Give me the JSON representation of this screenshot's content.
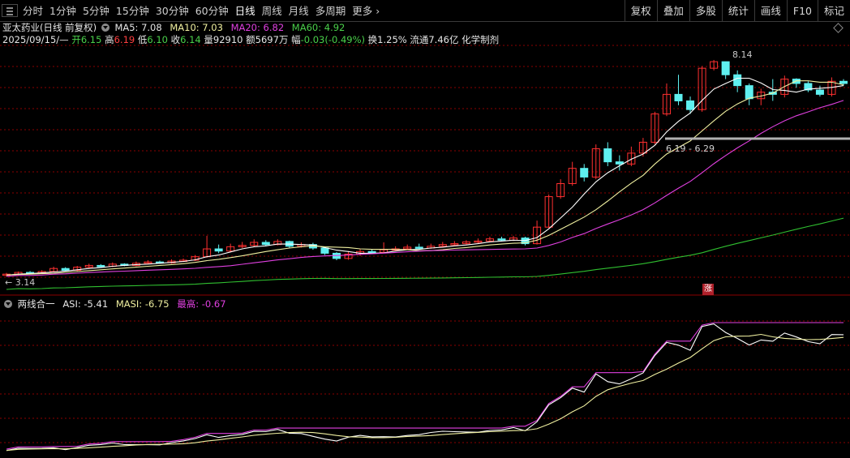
{
  "toolbar": {
    "period_tabs": [
      "分时",
      "1分钟",
      "5分钟",
      "15分钟",
      "30分钟",
      "60分钟",
      "日线",
      "周线",
      "月线",
      "多周期",
      "更多"
    ],
    "active_tab": "日线",
    "right_tools": [
      "复权",
      "叠加",
      "多股",
      "统计",
      "画线",
      "F10",
      "标记"
    ]
  },
  "info": {
    "stock": "亚太药业(日线 前复权)",
    "ma5": "MA5: 7.08",
    "ma10": "MA10: 7.03",
    "ma20": "MA20: 6.82",
    "ma60": "MA60: 4.92",
    "date": "2025/09/15/—",
    "open_label": "开",
    "open": "6.15",
    "high_label": "高",
    "high": "6.19",
    "low_label": "低",
    "low": "6.10",
    "close_label": "收",
    "close": "6.14",
    "vol_label": "量",
    "vol": "92910",
    "amt_label": "额",
    "amt": "5697万",
    "chg_label": "幅",
    "chg": "-0.03(-0.49%)",
    "turnover": "换1.25%",
    "float_cap": "流通7.46亿",
    "sector": "化学制剂"
  },
  "annotations": {
    "low_price": "← 3.14",
    "high_price": "8.14",
    "range": "6.19 - 6.29",
    "badge": "涨"
  },
  "indicator": {
    "name": "两线合一",
    "asi": "ASI: -5.41",
    "masi": "MASI: -6.75",
    "highest": "最高: -0.67"
  },
  "colors": {
    "up": "#ff3030",
    "down": "#5ff0f0",
    "ma5": "#ffffff",
    "ma10": "#f0f0a0",
    "ma20": "#e040e0",
    "ma60": "#30c030",
    "grid": "#8b0000"
  },
  "price_series": {
    "candles": [
      [
        3.2,
        3.22,
        3.16,
        3.25
      ],
      [
        3.22,
        3.26,
        3.19,
        3.28
      ],
      [
        3.26,
        3.24,
        3.22,
        3.29
      ],
      [
        3.24,
        3.28,
        3.22,
        3.31
      ],
      [
        3.28,
        3.35,
        3.26,
        3.39
      ],
      [
        3.35,
        3.31,
        3.29,
        3.38
      ],
      [
        3.31,
        3.38,
        3.29,
        3.41
      ],
      [
        3.38,
        3.42,
        3.36,
        3.46
      ],
      [
        3.42,
        3.4,
        3.37,
        3.45
      ],
      [
        3.4,
        3.45,
        3.38,
        3.49
      ],
      [
        3.45,
        3.42,
        3.4,
        3.47
      ],
      [
        3.42,
        3.47,
        3.4,
        3.51
      ],
      [
        3.47,
        3.5,
        3.45,
        3.54
      ],
      [
        3.5,
        3.48,
        3.46,
        3.53
      ],
      [
        3.48,
        3.52,
        3.46,
        3.56
      ],
      [
        3.52,
        3.54,
        3.5,
        3.58
      ],
      [
        3.54,
        3.62,
        3.52,
        3.66
      ],
      [
        3.62,
        3.8,
        3.6,
        4.1
      ],
      [
        3.8,
        3.75,
        3.7,
        3.9
      ],
      [
        3.75,
        3.85,
        3.72,
        3.92
      ],
      [
        3.85,
        3.88,
        3.82,
        3.96
      ],
      [
        3.88,
        3.95,
        3.85,
        4.02
      ],
      [
        3.95,
        3.9,
        3.86,
        4.0
      ],
      [
        3.9,
        3.97,
        3.88,
        4.02
      ],
      [
        3.97,
        3.86,
        3.82,
        3.99
      ],
      [
        3.86,
        3.9,
        3.83,
        3.95
      ],
      [
        3.9,
        3.82,
        3.78,
        3.94
      ],
      [
        3.82,
        3.7,
        3.66,
        3.85
      ],
      [
        3.7,
        3.58,
        3.54,
        3.73
      ],
      [
        3.58,
        3.68,
        3.55,
        3.75
      ],
      [
        3.68,
        3.74,
        3.64,
        3.8
      ],
      [
        3.74,
        3.72,
        3.68,
        3.8
      ],
      [
        3.72,
        3.78,
        3.7,
        3.95
      ],
      [
        3.78,
        3.8,
        3.75,
        3.86
      ],
      [
        3.8,
        3.84,
        3.78,
        3.9
      ],
      [
        3.84,
        3.82,
        3.78,
        3.92
      ],
      [
        3.82,
        3.86,
        3.8,
        3.92
      ],
      [
        3.86,
        3.9,
        3.84,
        3.96
      ],
      [
        3.9,
        3.92,
        3.88,
        3.98
      ],
      [
        3.92,
        3.96,
        3.9,
        4.0
      ],
      [
        3.96,
        3.98,
        3.93,
        4.04
      ],
      [
        3.98,
        4.03,
        3.96,
        4.08
      ],
      [
        4.03,
        4.0,
        3.98,
        4.08
      ],
      [
        4.0,
        4.05,
        3.98,
        4.1
      ],
      [
        4.05,
        3.92,
        3.88,
        4.08
      ],
      [
        3.92,
        4.3,
        3.9,
        4.45
      ],
      [
        4.3,
        5.0,
        4.28,
        5.05
      ],
      [
        5.0,
        5.3,
        4.95,
        5.4
      ],
      [
        5.3,
        5.65,
        5.25,
        5.8
      ],
      [
        5.65,
        5.45,
        5.35,
        5.75
      ],
      [
        5.45,
        6.1,
        5.4,
        6.2
      ],
      [
        6.1,
        5.8,
        5.7,
        6.25
      ],
      [
        5.8,
        5.75,
        5.6,
        5.95
      ],
      [
        5.75,
        6.0,
        5.7,
        6.15
      ],
      [
        6.0,
        6.25,
        5.92,
        6.35
      ],
      [
        6.25,
        6.9,
        6.2,
        6.95
      ],
      [
        6.9,
        7.35,
        6.85,
        7.6
      ],
      [
        7.35,
        7.2,
        7.1,
        7.8
      ],
      [
        7.2,
        7.0,
        6.9,
        7.3
      ],
      [
        7.0,
        7.95,
        6.95,
        8.0
      ],
      [
        7.95,
        8.1,
        7.9,
        8.14
      ],
      [
        8.1,
        7.8,
        7.7,
        8.05
      ],
      [
        7.8,
        7.55,
        7.4,
        7.9
      ],
      [
        7.55,
        7.25,
        7.1,
        7.6
      ],
      [
        7.25,
        7.4,
        7.1,
        7.48
      ],
      [
        7.4,
        7.35,
        7.2,
        7.7
      ],
      [
        7.35,
        7.7,
        7.28,
        7.78
      ],
      [
        7.7,
        7.6,
        7.5,
        7.72
      ],
      [
        7.6,
        7.45,
        7.4,
        7.65
      ],
      [
        7.45,
        7.35,
        7.3,
        7.55
      ],
      [
        7.35,
        7.65,
        7.3,
        7.74
      ],
      [
        7.65,
        7.6,
        7.55,
        7.7
      ]
    ],
    "ma5": [
      3.2,
      3.22,
      3.23,
      3.25,
      3.27,
      3.29,
      3.32,
      3.35,
      3.37,
      3.4,
      3.42,
      3.44,
      3.45,
      3.47,
      3.49,
      3.51,
      3.55,
      3.62,
      3.66,
      3.73,
      3.8,
      3.85,
      3.87,
      3.91,
      3.91,
      3.9,
      3.89,
      3.83,
      3.77,
      3.74,
      3.7,
      3.7,
      3.71,
      3.75,
      3.78,
      3.79,
      3.82,
      3.84,
      3.87,
      3.89,
      3.92,
      3.96,
      3.98,
      4.0,
      3.99,
      4.06,
      4.26,
      4.51,
      4.76,
      5.06,
      5.34,
      5.55,
      5.71,
      5.86,
      5.98,
      6.18,
      6.49,
      6.73,
      6.92,
      7.21,
      7.47,
      7.6,
      7.72,
      7.72,
      7.61,
      7.46,
      7.44,
      7.4,
      7.47,
      7.49,
      7.51,
      7.55
    ],
    "ma10": [
      3.2,
      3.21,
      3.22,
      3.23,
      3.24,
      3.26,
      3.28,
      3.3,
      3.32,
      3.34,
      3.36,
      3.38,
      3.4,
      3.42,
      3.44,
      3.46,
      3.49,
      3.53,
      3.56,
      3.6,
      3.64,
      3.69,
      3.74,
      3.78,
      3.82,
      3.85,
      3.87,
      3.85,
      3.84,
      3.83,
      3.8,
      3.79,
      3.79,
      3.79,
      3.78,
      3.76,
      3.76,
      3.78,
      3.81,
      3.83,
      3.86,
      3.89,
      3.91,
      3.93,
      3.94,
      4.0,
      4.11,
      4.25,
      4.39,
      4.53,
      4.7,
      4.9,
      5.11,
      5.31,
      5.49,
      5.75,
      5.98,
      6.13,
      6.28,
      6.51,
      6.74,
      6.96,
      7.13,
      7.26,
      7.31,
      7.38,
      7.53,
      7.66,
      7.66,
      7.63,
      7.63,
      7.57
    ]
  }
}
